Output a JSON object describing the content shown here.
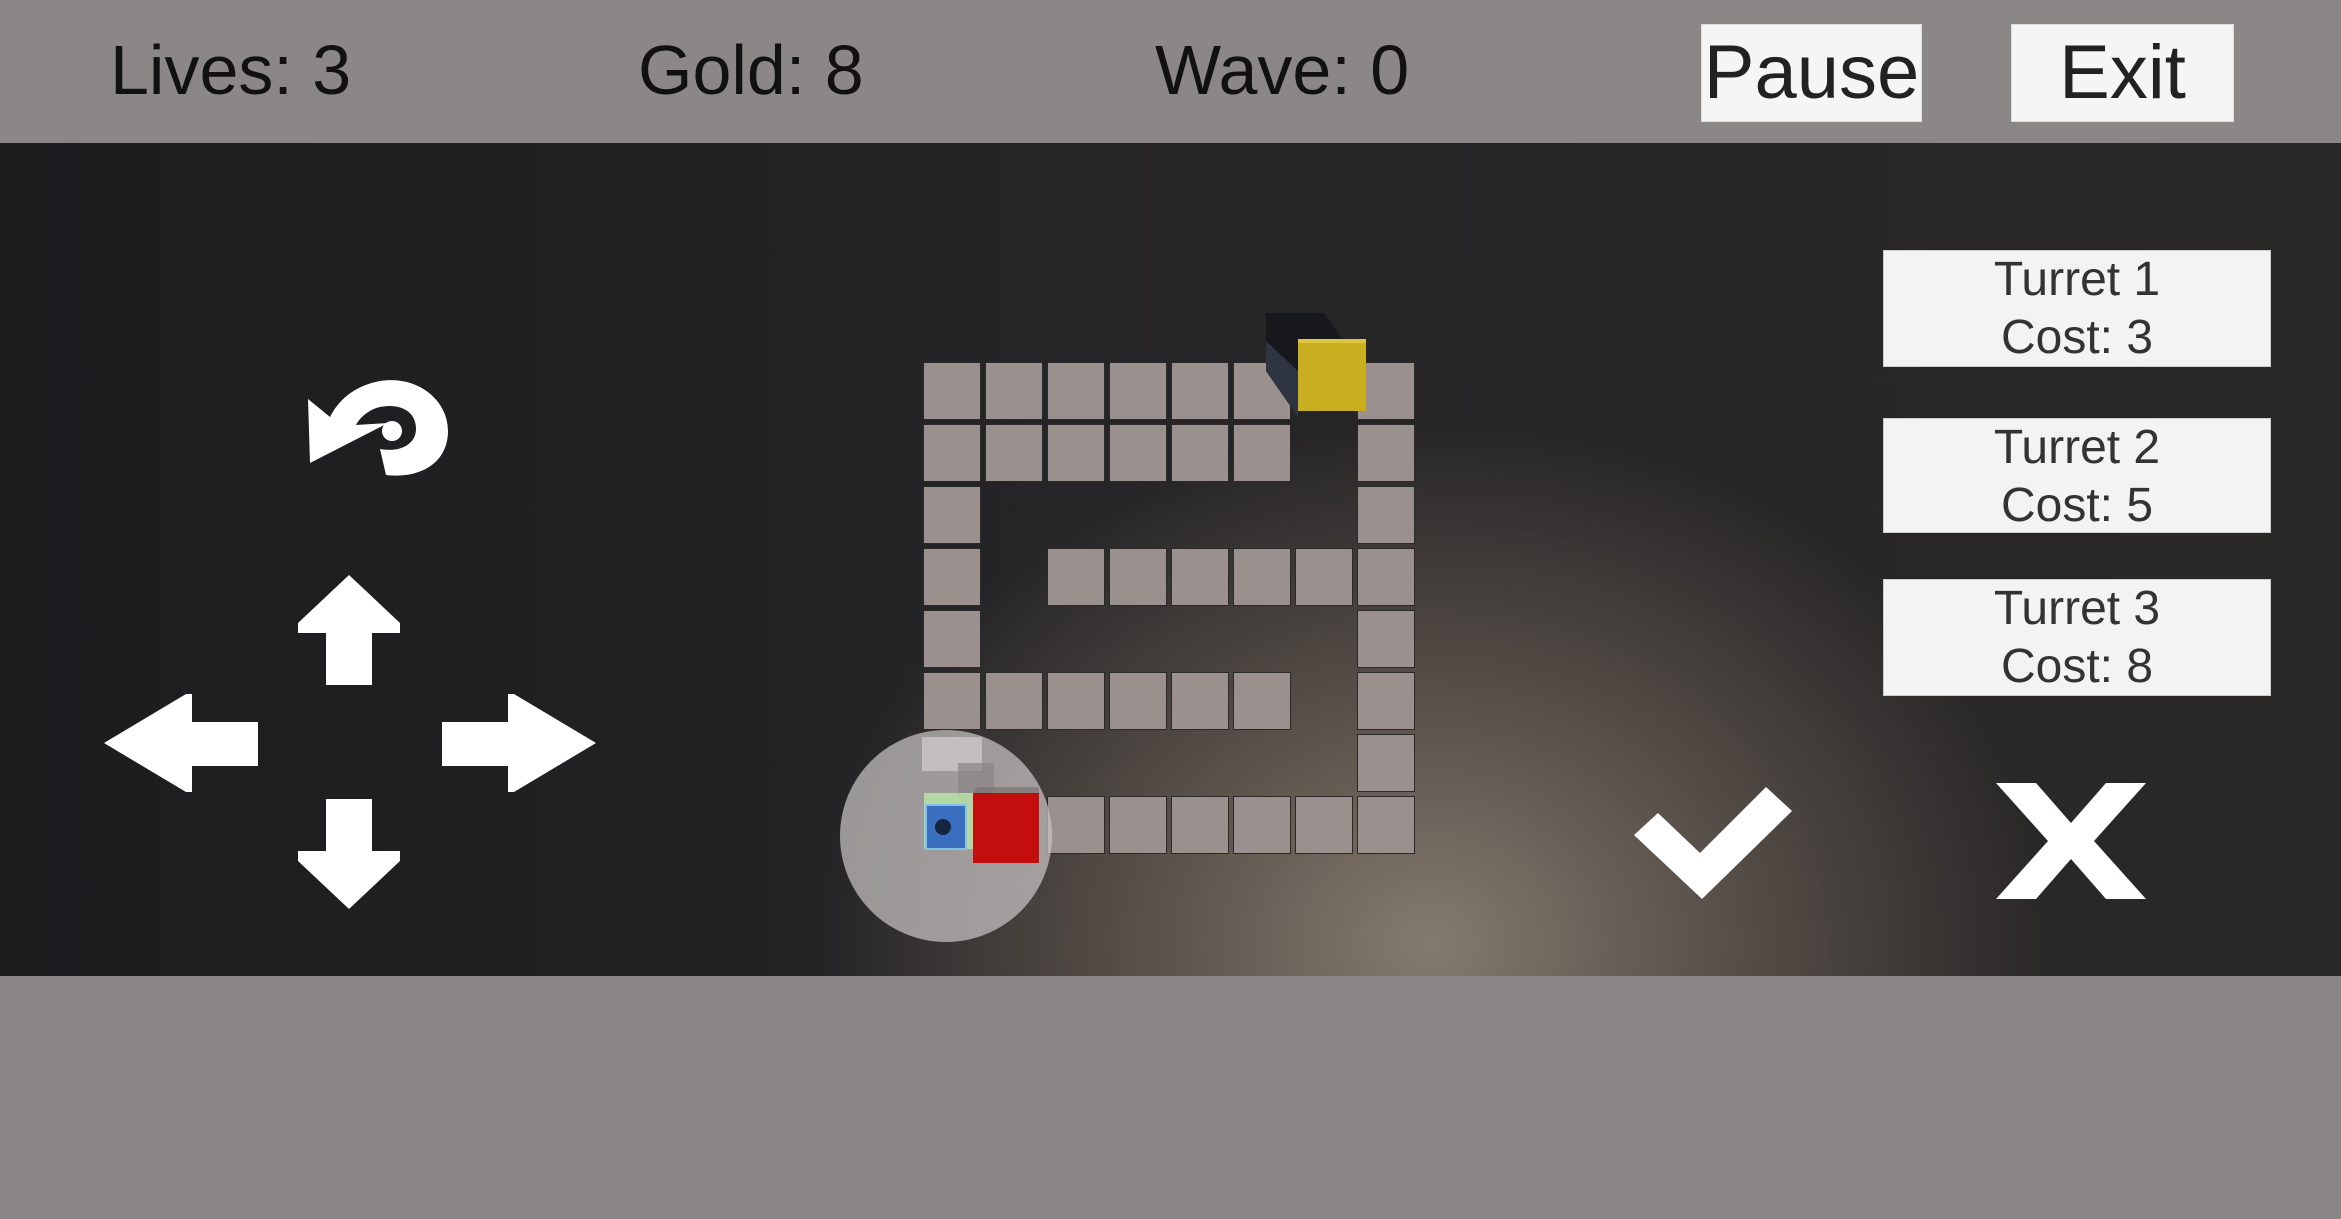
{
  "hud": {
    "lives": "Lives: 3",
    "gold": "Gold: 8",
    "wave": "Wave: 0",
    "pause_label": "Pause",
    "exit_label": "Exit"
  },
  "turrets": [
    {
      "name": "Turret 1",
      "cost": "Cost: 3"
    },
    {
      "name": "Turret 2",
      "cost": "Cost: 5"
    },
    {
      "name": "Turret 3",
      "cost": "Cost: 8"
    }
  ],
  "controls": {
    "icons": [
      "rotate-icon",
      "arrow-up-icon",
      "arrow-left-icon",
      "arrow-right-icon",
      "arrow-down-icon",
      "checkmark-icon",
      "cross-icon"
    ]
  },
  "colors": {
    "hud_bg": "#8c8787",
    "path_tile": "#9a918e",
    "goal_cube": "#c9ae1f",
    "placement_cube": "#c40d0d",
    "turret_cube": "#3a6fc0",
    "icon": "#ffffff"
  }
}
